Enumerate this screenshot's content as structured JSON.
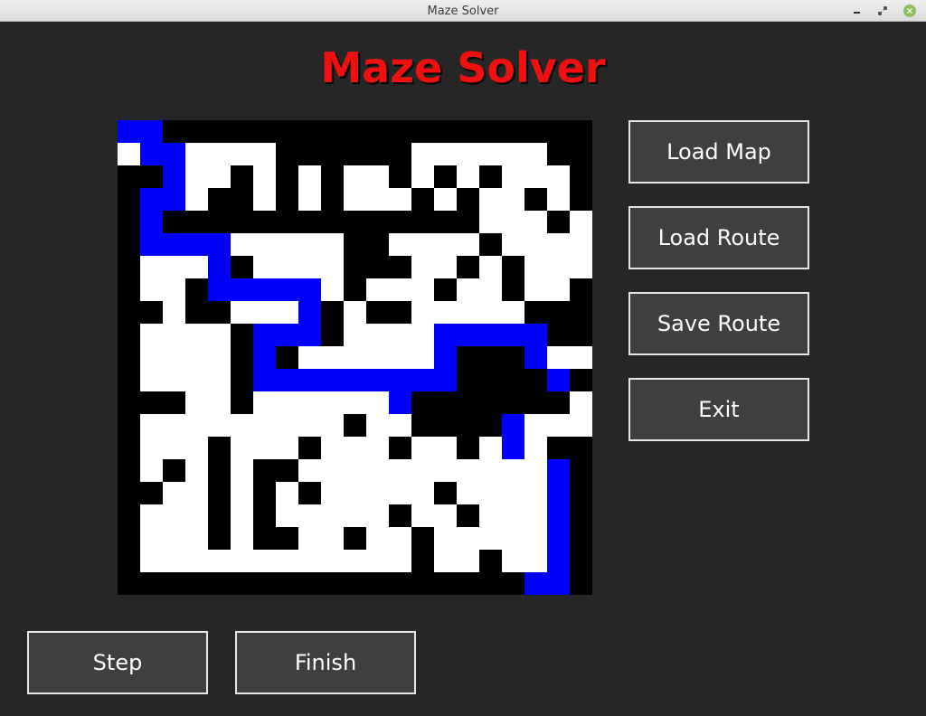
{
  "window": {
    "title": "Maze Solver",
    "controls": [
      "minimize-icon",
      "restore-icon",
      "close-icon"
    ]
  },
  "app": {
    "heading": "Maze Solver"
  },
  "buttons": {
    "load_map": "Load Map",
    "load_route": "Load Route",
    "save_route": "Save Route",
    "exit": "Exit",
    "step": "Step",
    "finish": "Finish"
  },
  "colors": {
    "background": "#262626",
    "heading": "#f01010",
    "wall": "#000000",
    "open": "#ffffff",
    "route": "#0000ff"
  },
  "maze": {
    "rows": 21,
    "cols": 21,
    "legend": {
      "#": "wall",
      ".": "open",
      "R": "route"
    },
    "grid": [
      "RR###################",
      ".RR....######......##",
      "##R..#.#.#..#.#.#...#",
      "#RR.##.#.#...#.#..#.#",
      "#R##############...#.",
      "#RRRR.....##....#....",
      "#...R#....###..#.#...",
      "#..#RRRRR.#...#..#..#",
      "##.##...R#.##.....###",
      "#....#RRR#....RRRRR##",
      "#....#R#......R###R..",
      "#....#RRRRRRRRR####R#",
      "###..#......R#######.",
      "#.........#..####R...",
      "#...#...#...#..#.R.##",
      "#.#.#.##...........R#",
      "##..#.#.#.....#....R#",
      "#...#.#.....#..#...R#",
      "#...#.##..#..#.....R#",
      "#............#..#..R#",
      "##################RR#"
    ]
  }
}
